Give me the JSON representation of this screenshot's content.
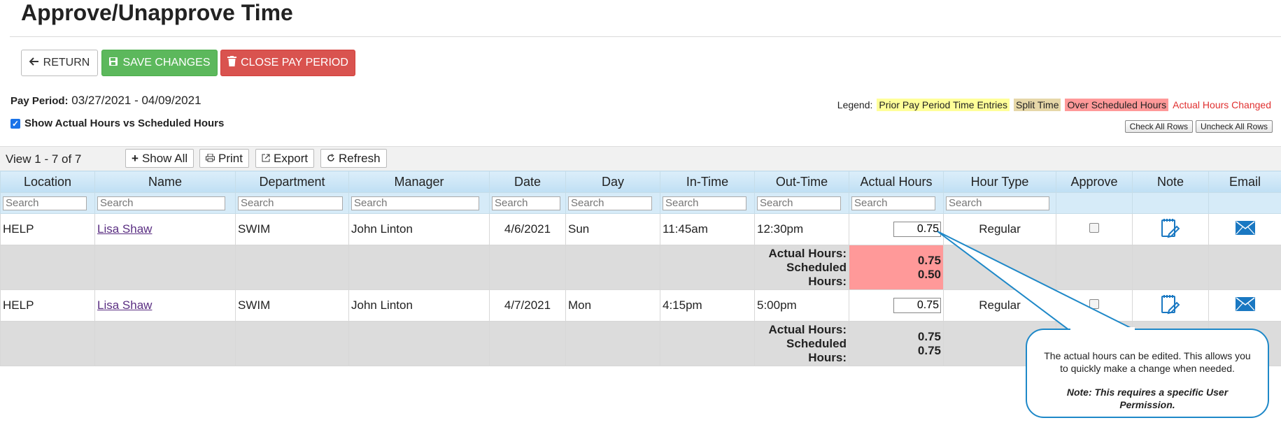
{
  "page": {
    "title": "Approve/Unapprove Time"
  },
  "buttons": {
    "return_label": "RETURN",
    "save_label": "SAVE CHANGES",
    "close_label": "CLOSE PAY PERIOD"
  },
  "pay_period": {
    "label": "Pay Period:",
    "value": "03/27/2021 - 04/09/2021"
  },
  "show_actual": {
    "label": "Show Actual Hours vs Scheduled Hours",
    "checked": true
  },
  "legend": {
    "label": "Legend:",
    "prior": "Prior Pay Period Time Entries",
    "split": "Split Time",
    "over": "Over Scheduled Hours",
    "changed": "Actual Hours Changed",
    "colors": {
      "prior": "#ffff99",
      "split": "#e6d7a8",
      "over": "#ff9999",
      "changed": "#e03030"
    }
  },
  "row_buttons": {
    "check_all": "Check All Rows",
    "uncheck_all": "Uncheck All Rows"
  },
  "toolbar": {
    "view_text": "View 1 - 7 of 7",
    "show_all": "Show All",
    "print": "Print",
    "export": "Export",
    "refresh": "Refresh"
  },
  "table": {
    "columns": [
      "Location",
      "Name",
      "Department",
      "Manager",
      "Date",
      "Day",
      "In-Time",
      "Out-Time",
      "Actual Hours",
      "Hour Type",
      "Approve",
      "Note",
      "Email"
    ],
    "search_placeholder": "Search",
    "rows": [
      {
        "location": "HELP",
        "name": "Lisa Shaw",
        "department": "SWIM",
        "manager": "John Linton",
        "date": "4/6/2021",
        "day": "Sun",
        "in_time": "11:45am",
        "out_time": "12:30pm",
        "actual_hours": "0.75",
        "hour_type": "Regular",
        "sub": {
          "actual_label": "Actual Hours:",
          "scheduled_label": "Scheduled Hours:",
          "actual": "0.75",
          "scheduled": "0.50"
        }
      },
      {
        "location": "HELP",
        "name": "Lisa Shaw",
        "department": "SWIM",
        "manager": "John Linton",
        "date": "4/7/2021",
        "day": "Mon",
        "in_time": "4:15pm",
        "out_time": "5:00pm",
        "actual_hours": "0.75",
        "hour_type": "Regular",
        "sub": {
          "actual_label": "Actual Hours:",
          "scheduled_label": "Scheduled Hours:",
          "actual": "0.75",
          "scheduled": "0.75"
        }
      }
    ]
  },
  "callout": {
    "text": "The actual hours can be edited. This allows you to quickly make a change when needed.",
    "note": "Note: This requires a specific User Permission."
  }
}
